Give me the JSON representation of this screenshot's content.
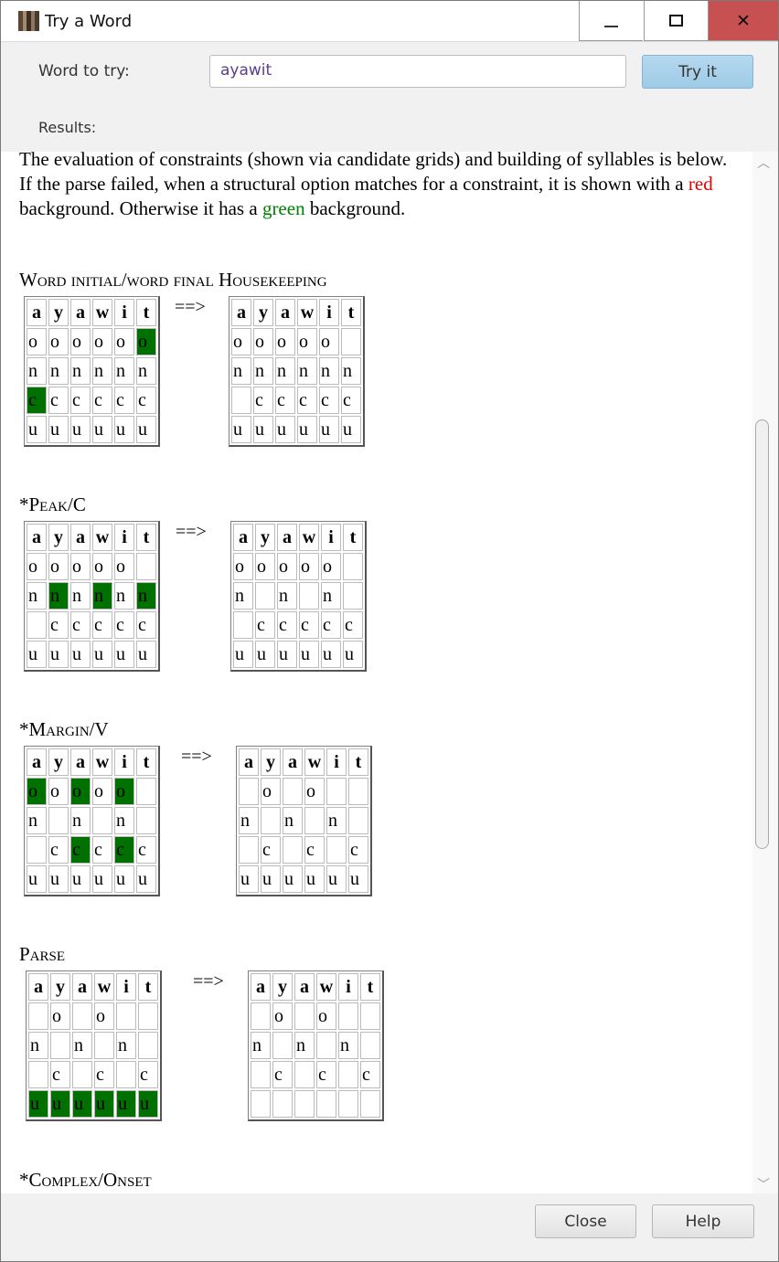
{
  "window": {
    "title": "Try a Word",
    "minimize_icon": "minimize-icon",
    "maximize_icon": "maximize-icon",
    "close_glyph": "✕"
  },
  "form": {
    "word_label": "Word to try:",
    "word_value": "ayawit",
    "try_button": "Try it",
    "results_label": "Results:"
  },
  "intro": {
    "part1": "The evaluation of constraints (shown via candidate grids) and building of syllables is below. If the parse failed, when a structural option matches for a constraint, it is shown with a ",
    "red_word": "red",
    "part2": " background. Otherwise it has a ",
    "green_word": "green",
    "part3": " background."
  },
  "arrow": "==>",
  "letters": [
    "a",
    "y",
    "a",
    "w",
    "i",
    "t"
  ],
  "sections": [
    {
      "title": "Word initial/word final Housekeeping",
      "before": {
        "rows": [
          [
            "o",
            "o",
            "o",
            "o",
            "o",
            "o"
          ],
          [
            "n",
            "n",
            "n",
            "n",
            "n",
            "n"
          ],
          [
            "c",
            "c",
            "c",
            "c",
            "c",
            "c"
          ],
          [
            "u",
            "u",
            "u",
            "u",
            "u",
            "u"
          ]
        ],
        "highlight": [
          [
            0,
            5
          ],
          [
            2,
            0
          ]
        ]
      },
      "after": {
        "rows": [
          [
            "o",
            "o",
            "o",
            "o",
            "o",
            ""
          ],
          [
            "n",
            "n",
            "n",
            "n",
            "n",
            "n"
          ],
          [
            "",
            "c",
            "c",
            "c",
            "c",
            "c"
          ],
          [
            "u",
            "u",
            "u",
            "u",
            "u",
            "u"
          ]
        ]
      }
    },
    {
      "title": "*Peak/C",
      "before": {
        "rows": [
          [
            "o",
            "o",
            "o",
            "o",
            "o",
            ""
          ],
          [
            "n",
            "n",
            "n",
            "n",
            "n",
            "n"
          ],
          [
            "",
            "c",
            "c",
            "c",
            "c",
            "c"
          ],
          [
            "u",
            "u",
            "u",
            "u",
            "u",
            "u"
          ]
        ],
        "highlight": [
          [
            1,
            1
          ],
          [
            1,
            3
          ],
          [
            1,
            5
          ]
        ]
      },
      "after": {
        "rows": [
          [
            "o",
            "o",
            "o",
            "o",
            "o",
            ""
          ],
          [
            "n",
            "",
            "n",
            "",
            "n",
            ""
          ],
          [
            "",
            "c",
            "c",
            "c",
            "c",
            "c"
          ],
          [
            "u",
            "u",
            "u",
            "u",
            "u",
            "u"
          ]
        ]
      }
    },
    {
      "title": "*Margin/V",
      "before": {
        "rows": [
          [
            "o",
            "o",
            "o",
            "o",
            "o",
            ""
          ],
          [
            "n",
            "",
            "n",
            "",
            "n",
            ""
          ],
          [
            "",
            "c",
            "c",
            "c",
            "c",
            "c"
          ],
          [
            "u",
            "u",
            "u",
            "u",
            "u",
            "u"
          ]
        ],
        "highlight": [
          [
            0,
            0
          ],
          [
            0,
            2
          ],
          [
            0,
            4
          ],
          [
            2,
            2
          ],
          [
            2,
            4
          ]
        ]
      },
      "after": {
        "rows": [
          [
            "",
            "o",
            "",
            "o",
            "",
            ""
          ],
          [
            "n",
            "",
            "n",
            "",
            "n",
            ""
          ],
          [
            "",
            "c",
            "",
            "c",
            "",
            "c"
          ],
          [
            "u",
            "u",
            "u",
            "u",
            "u",
            "u"
          ]
        ]
      }
    },
    {
      "title": "Parse",
      "before": {
        "rows": [
          [
            "",
            "o",
            "",
            "o",
            "",
            ""
          ],
          [
            "n",
            "",
            "n",
            "",
            "n",
            ""
          ],
          [
            "",
            "c",
            "",
            "c",
            "",
            "c"
          ],
          [
            "u",
            "u",
            "u",
            "u",
            "u",
            "u"
          ]
        ],
        "highlight": [
          [
            3,
            0
          ],
          [
            3,
            1
          ],
          [
            3,
            2
          ],
          [
            3,
            3
          ],
          [
            3,
            4
          ],
          [
            3,
            5
          ]
        ]
      },
      "after": {
        "rows": [
          [
            "",
            "o",
            "",
            "o",
            "",
            ""
          ],
          [
            "n",
            "",
            "n",
            "",
            "n",
            ""
          ],
          [
            "",
            "c",
            "",
            "c",
            "",
            "c"
          ],
          [
            "",
            "",
            "",
            "",
            "",
            ""
          ]
        ]
      }
    }
  ],
  "next_section_title": "*Complex/Onset",
  "buttons": {
    "close": "Close",
    "help": "Help"
  },
  "colors": {
    "match_green": "#007000",
    "red_text": "#e00000",
    "green_text": "#008000",
    "close_hover": "#c75050",
    "try_button": "#a8d2ec"
  }
}
